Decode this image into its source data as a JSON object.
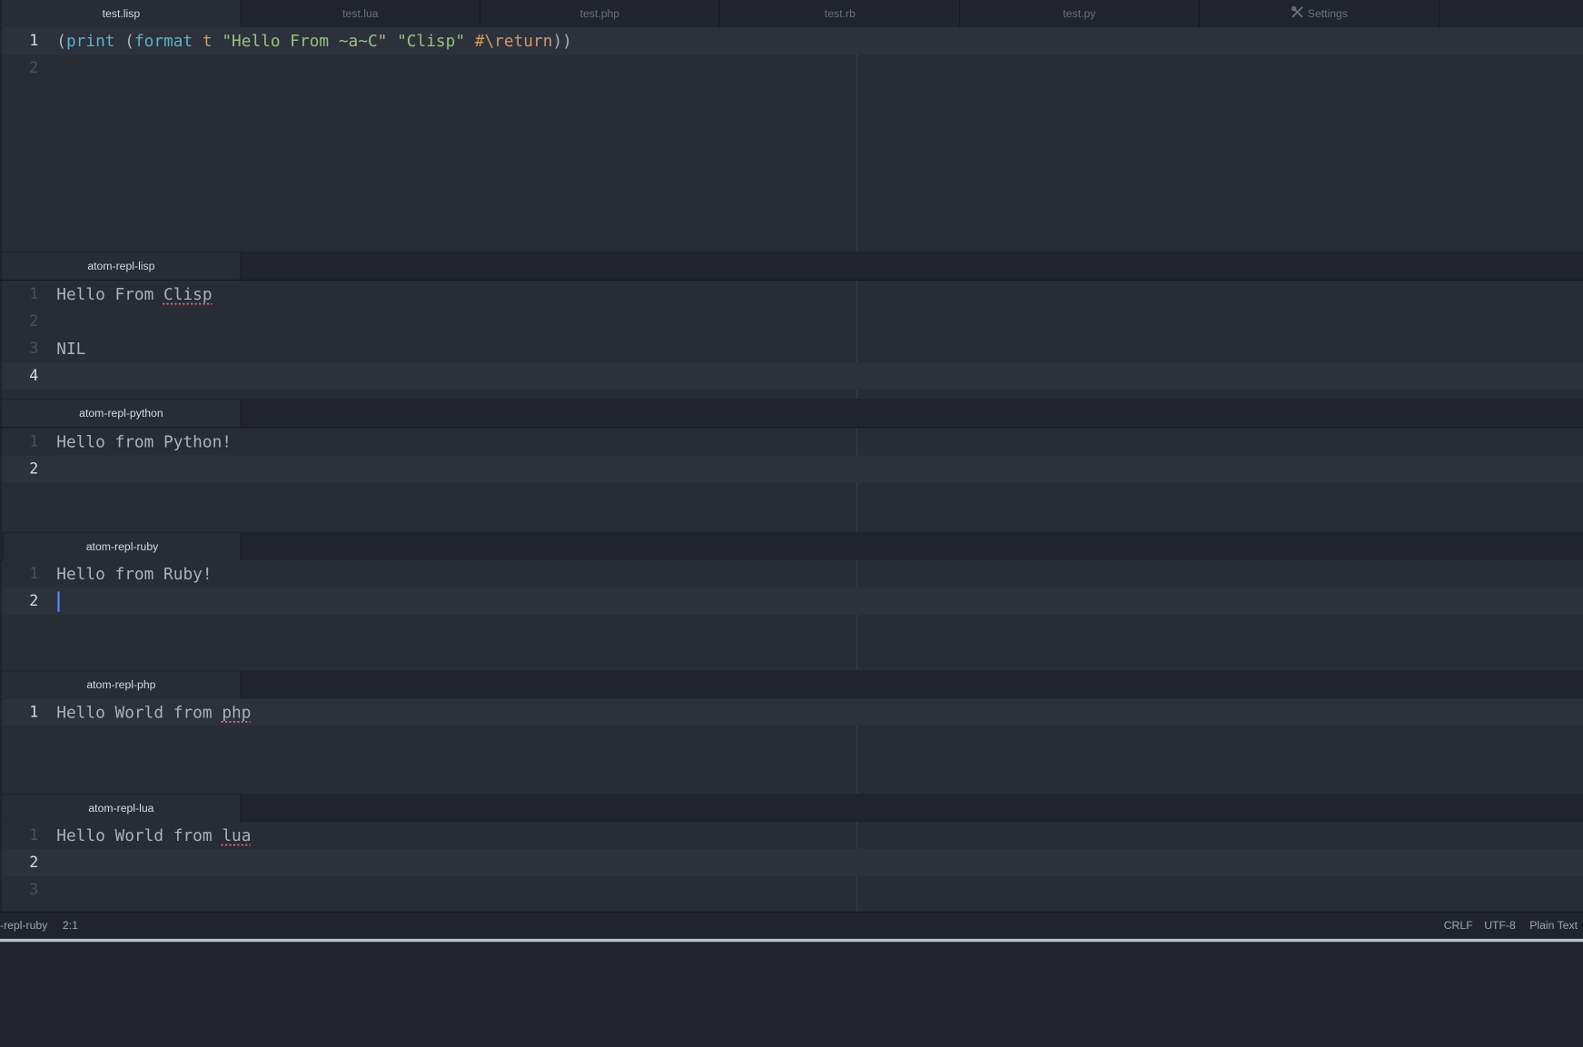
{
  "top_tabs": [
    {
      "label": "test.lisp",
      "active": true
    },
    {
      "label": "test.lua",
      "active": false
    },
    {
      "label": "test.php",
      "active": false
    },
    {
      "label": "test.rb",
      "active": false
    },
    {
      "label": "test.py",
      "active": false
    },
    {
      "label": "Settings",
      "active": false,
      "icon": "tools-icon"
    }
  ],
  "main_editor": {
    "line_numbers": [
      "1",
      "2"
    ],
    "code_tokens": [
      "(",
      "print",
      " (",
      "format",
      " t ",
      "\"Hello From ~a~C\" \"Clisp\"",
      " #\\return",
      "))"
    ]
  },
  "panes": {
    "lisp": {
      "tab_label": "atom-repl-lisp",
      "line_numbers": [
        "1",
        "2",
        "3",
        "4"
      ],
      "lines": [
        "Hello From ",
        "Clisp",
        "",
        "NIL",
        ""
      ]
    },
    "python": {
      "tab_label": "atom-repl-python",
      "line_numbers": [
        "1",
        "2"
      ],
      "lines": [
        "Hello from Python!",
        ""
      ]
    },
    "ruby": {
      "tab_label": "atom-repl-ruby",
      "line_numbers": [
        "1",
        "2"
      ],
      "lines": [
        "Hello from Ruby!",
        ""
      ]
    },
    "php": {
      "tab_label": "atom-repl-php",
      "line_numbers": [
        "1"
      ],
      "lines": [
        "Hello World from ",
        "php"
      ]
    },
    "lua": {
      "tab_label": "atom-repl-lua",
      "line_numbers": [
        "1",
        "2",
        "3"
      ],
      "lines": [
        "Hello World from ",
        "lua",
        "",
        ""
      ]
    }
  },
  "status_bar": {
    "file": "-repl-ruby",
    "position": "2:1",
    "line_ending": "CRLF",
    "encoding": "UTF-8",
    "grammar": "Plain Text"
  },
  "colors": {
    "background": "#282c34",
    "chrome": "#21252b",
    "cursor": "#528bff"
  }
}
